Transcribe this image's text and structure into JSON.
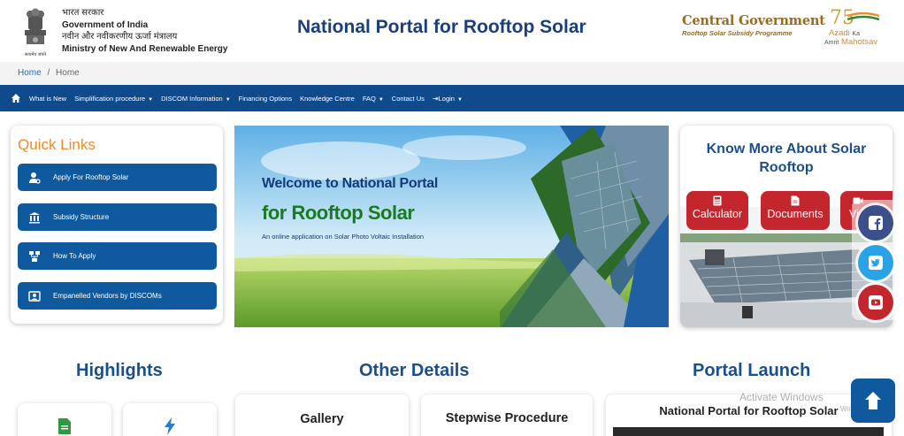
{
  "header": {
    "gov_hindi": "भारत सरकार",
    "gov_english": "Government of India",
    "ministry_hindi": "नवीन और नवीकरणीय ऊर्जा मंत्रालय",
    "ministry_english": "Ministry of New And Renewable Energy",
    "emblem_motto": "सत्यमेव जयते",
    "title": "National Portal for Rooftop Solar",
    "cg_line1": "Central Government",
    "cg_line2": "Rooftop Solar Subsidy Programme",
    "azadi_num": "75",
    "azadi_line1": "Azadi",
    "azadi_ka": "Ka",
    "azadi_line2": "Amrit",
    "azadi_mahotsav": "Mahotsav"
  },
  "breadcrumb": {
    "home": "Home",
    "sep": "/",
    "current": "Home"
  },
  "nav": {
    "items": [
      "What is New",
      "Simplification procedure",
      "DISCOM Information",
      "Financing Options",
      "Knowledge Centre",
      "FAQ",
      "Contact Us",
      "Login"
    ]
  },
  "quick_links": {
    "title": "Quick Links",
    "items": [
      "Apply For Rooftop Solar",
      "Subsidy Structure",
      "How To Apply",
      "Empanelled Vendors by DISCOMs"
    ]
  },
  "banner": {
    "line1": "Welcome to National Portal",
    "line2": "for Rooftop Solar",
    "line3": "An online application on Solar Photo Voltaic Installation"
  },
  "know_more": {
    "title_line1": "Know More About Solar",
    "title_line2": "Rooftop",
    "buttons": [
      "Calculator",
      "Documents",
      "Vi"
    ]
  },
  "sections": {
    "highlights": "Highlights",
    "other_details": "Other Details",
    "portal_launch": "Portal Launch",
    "gallery": "Gallery",
    "stepwise": "Stepwise Procedure",
    "launch_card": "National Portal for Rooftop Solar"
  },
  "watermark": {
    "line1": "Activate Windows",
    "line2": "Windows"
  },
  "colors": {
    "primary": "#0f5a9e",
    "nav": "#0f4b8c",
    "accent": "#f0892a",
    "red": "#c4262d",
    "title": "#1b3f7a"
  }
}
